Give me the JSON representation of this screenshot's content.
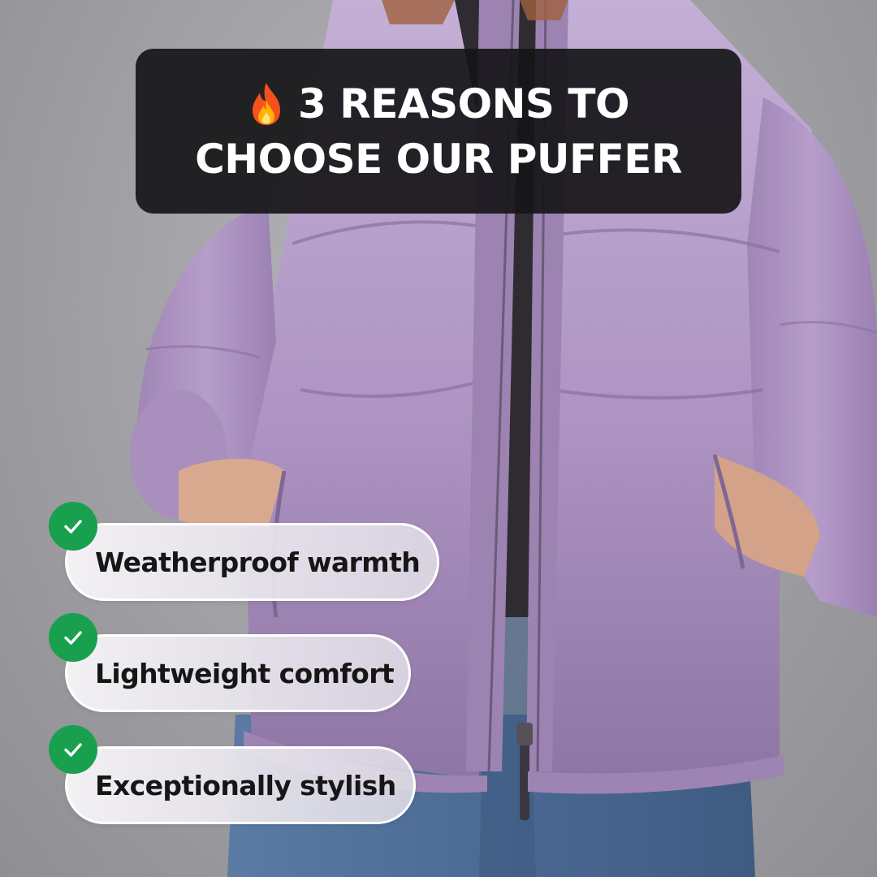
{
  "headline": {
    "icon": "fire-icon",
    "line1": "3 REASONS TO",
    "line2": "CHOOSE OUR PUFFER"
  },
  "benefits": [
    {
      "label": "Weatherproof warmth",
      "icon": "check-icon"
    },
    {
      "label": "Lightweight comfort",
      "icon": "check-icon"
    },
    {
      "label": "Exceptionally stylish",
      "icon": "check-icon"
    }
  ],
  "colors": {
    "jacket": "#b49ac7",
    "check_green": "#18a04f",
    "headline_bg": "#161618",
    "jeans": "#4d6f9b"
  }
}
